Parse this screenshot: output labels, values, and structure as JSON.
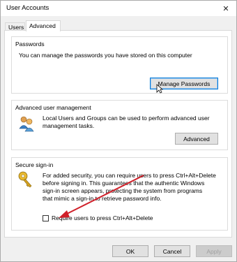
{
  "window": {
    "title": "User Accounts",
    "close_icon": "close-icon"
  },
  "tabs": [
    {
      "label": "Users",
      "active": false
    },
    {
      "label": "Advanced",
      "active": true
    }
  ],
  "passwords": {
    "heading": "Passwords",
    "description": "You can manage the passwords you have stored on this computer",
    "button": "Manage Passwords"
  },
  "advanced_management": {
    "heading": "Advanced user management",
    "line1": "Local Users and Groups can be used to perform advanced user",
    "line2": "management tasks.",
    "button": "Advanced",
    "icon": "users-group-icon"
  },
  "secure_signin": {
    "heading": "Secure sign-in",
    "line1": "For added security, you can require users to press Ctrl+Alt+Delete",
    "line2": "before signing in. This guarantees that the authentic Windows",
    "line3": "sign-in screen appears, protecting the system from programs",
    "line4": "that mimic a sign-in to retrieve password info.",
    "checkbox_label": "Require users to press Ctrl+Alt+Delete",
    "checked": false,
    "icon": "key-icon"
  },
  "footer": {
    "ok": "OK",
    "cancel": "Cancel",
    "apply": "Apply"
  },
  "colors": {
    "focus_border": "#0078d7",
    "arrow": "#d0202a"
  }
}
